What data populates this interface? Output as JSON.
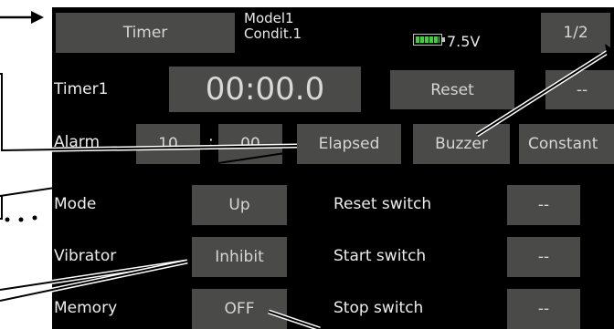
{
  "header": {
    "timer_tab": "Timer",
    "model_name": "Model1",
    "condition": "Condit.1",
    "voltage": "7.5V",
    "page_indicator": "1/2"
  },
  "timer": {
    "label": "Timer1",
    "display": "00:00.0",
    "reset_label": "Reset",
    "right_button": "--"
  },
  "alarm": {
    "label": "Alarm",
    "minutes": "10",
    "separator": ":",
    "seconds": "00",
    "elapsed_label": "Elapsed",
    "buzzer_label": "Buzzer",
    "constant_label": "Constant"
  },
  "settings": {
    "mode_label": "Mode",
    "mode_value": "Up",
    "vibrator_label": "Vibrator",
    "vibrator_value": "Inhibit",
    "memory_label": "Memory",
    "memory_value": "OFF",
    "reset_switch_label": "Reset switch",
    "reset_switch_value": "--",
    "start_switch_label": "Start switch",
    "start_switch_value": "--",
    "stop_switch_label": "Stop switch",
    "stop_switch_value": "--"
  },
  "colors": {
    "screen_bg": "#000000",
    "button_bg": "#4a4a48",
    "battery_green": "#3ed03e"
  }
}
